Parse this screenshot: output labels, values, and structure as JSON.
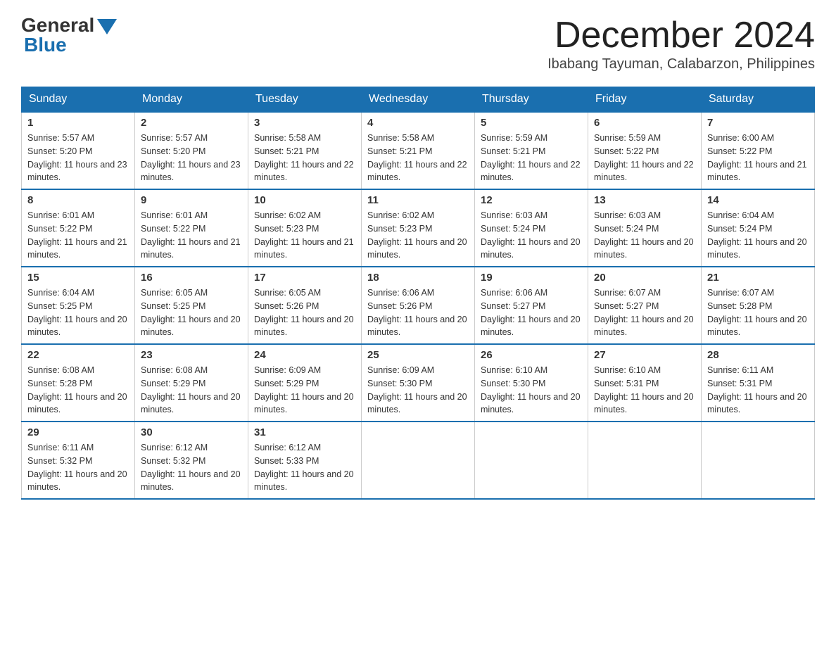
{
  "header": {
    "logo_general": "General",
    "logo_blue": "Blue",
    "month_title": "December 2024",
    "subtitle": "Ibabang Tayuman, Calabarzon, Philippines"
  },
  "days_of_week": [
    "Sunday",
    "Monday",
    "Tuesday",
    "Wednesday",
    "Thursday",
    "Friday",
    "Saturday"
  ],
  "weeks": [
    [
      {
        "day": "1",
        "sunrise": "5:57 AM",
        "sunset": "5:20 PM",
        "daylight": "11 hours and 23 minutes."
      },
      {
        "day": "2",
        "sunrise": "5:57 AM",
        "sunset": "5:20 PM",
        "daylight": "11 hours and 23 minutes."
      },
      {
        "day": "3",
        "sunrise": "5:58 AM",
        "sunset": "5:21 PM",
        "daylight": "11 hours and 22 minutes."
      },
      {
        "day": "4",
        "sunrise": "5:58 AM",
        "sunset": "5:21 PM",
        "daylight": "11 hours and 22 minutes."
      },
      {
        "day": "5",
        "sunrise": "5:59 AM",
        "sunset": "5:21 PM",
        "daylight": "11 hours and 22 minutes."
      },
      {
        "day": "6",
        "sunrise": "5:59 AM",
        "sunset": "5:22 PM",
        "daylight": "11 hours and 22 minutes."
      },
      {
        "day": "7",
        "sunrise": "6:00 AM",
        "sunset": "5:22 PM",
        "daylight": "11 hours and 21 minutes."
      }
    ],
    [
      {
        "day": "8",
        "sunrise": "6:01 AM",
        "sunset": "5:22 PM",
        "daylight": "11 hours and 21 minutes."
      },
      {
        "day": "9",
        "sunrise": "6:01 AM",
        "sunset": "5:22 PM",
        "daylight": "11 hours and 21 minutes."
      },
      {
        "day": "10",
        "sunrise": "6:02 AM",
        "sunset": "5:23 PM",
        "daylight": "11 hours and 21 minutes."
      },
      {
        "day": "11",
        "sunrise": "6:02 AM",
        "sunset": "5:23 PM",
        "daylight": "11 hours and 20 minutes."
      },
      {
        "day": "12",
        "sunrise": "6:03 AM",
        "sunset": "5:24 PM",
        "daylight": "11 hours and 20 minutes."
      },
      {
        "day": "13",
        "sunrise": "6:03 AM",
        "sunset": "5:24 PM",
        "daylight": "11 hours and 20 minutes."
      },
      {
        "day": "14",
        "sunrise": "6:04 AM",
        "sunset": "5:24 PM",
        "daylight": "11 hours and 20 minutes."
      }
    ],
    [
      {
        "day": "15",
        "sunrise": "6:04 AM",
        "sunset": "5:25 PM",
        "daylight": "11 hours and 20 minutes."
      },
      {
        "day": "16",
        "sunrise": "6:05 AM",
        "sunset": "5:25 PM",
        "daylight": "11 hours and 20 minutes."
      },
      {
        "day": "17",
        "sunrise": "6:05 AM",
        "sunset": "5:26 PM",
        "daylight": "11 hours and 20 minutes."
      },
      {
        "day": "18",
        "sunrise": "6:06 AM",
        "sunset": "5:26 PM",
        "daylight": "11 hours and 20 minutes."
      },
      {
        "day": "19",
        "sunrise": "6:06 AM",
        "sunset": "5:27 PM",
        "daylight": "11 hours and 20 minutes."
      },
      {
        "day": "20",
        "sunrise": "6:07 AM",
        "sunset": "5:27 PM",
        "daylight": "11 hours and 20 minutes."
      },
      {
        "day": "21",
        "sunrise": "6:07 AM",
        "sunset": "5:28 PM",
        "daylight": "11 hours and 20 minutes."
      }
    ],
    [
      {
        "day": "22",
        "sunrise": "6:08 AM",
        "sunset": "5:28 PM",
        "daylight": "11 hours and 20 minutes."
      },
      {
        "day": "23",
        "sunrise": "6:08 AM",
        "sunset": "5:29 PM",
        "daylight": "11 hours and 20 minutes."
      },
      {
        "day": "24",
        "sunrise": "6:09 AM",
        "sunset": "5:29 PM",
        "daylight": "11 hours and 20 minutes."
      },
      {
        "day": "25",
        "sunrise": "6:09 AM",
        "sunset": "5:30 PM",
        "daylight": "11 hours and 20 minutes."
      },
      {
        "day": "26",
        "sunrise": "6:10 AM",
        "sunset": "5:30 PM",
        "daylight": "11 hours and 20 minutes."
      },
      {
        "day": "27",
        "sunrise": "6:10 AM",
        "sunset": "5:31 PM",
        "daylight": "11 hours and 20 minutes."
      },
      {
        "day": "28",
        "sunrise": "6:11 AM",
        "sunset": "5:31 PM",
        "daylight": "11 hours and 20 minutes."
      }
    ],
    [
      {
        "day": "29",
        "sunrise": "6:11 AM",
        "sunset": "5:32 PM",
        "daylight": "11 hours and 20 minutes."
      },
      {
        "day": "30",
        "sunrise": "6:12 AM",
        "sunset": "5:32 PM",
        "daylight": "11 hours and 20 minutes."
      },
      {
        "day": "31",
        "sunrise": "6:12 AM",
        "sunset": "5:33 PM",
        "daylight": "11 hours and 20 minutes."
      },
      null,
      null,
      null,
      null
    ]
  ]
}
